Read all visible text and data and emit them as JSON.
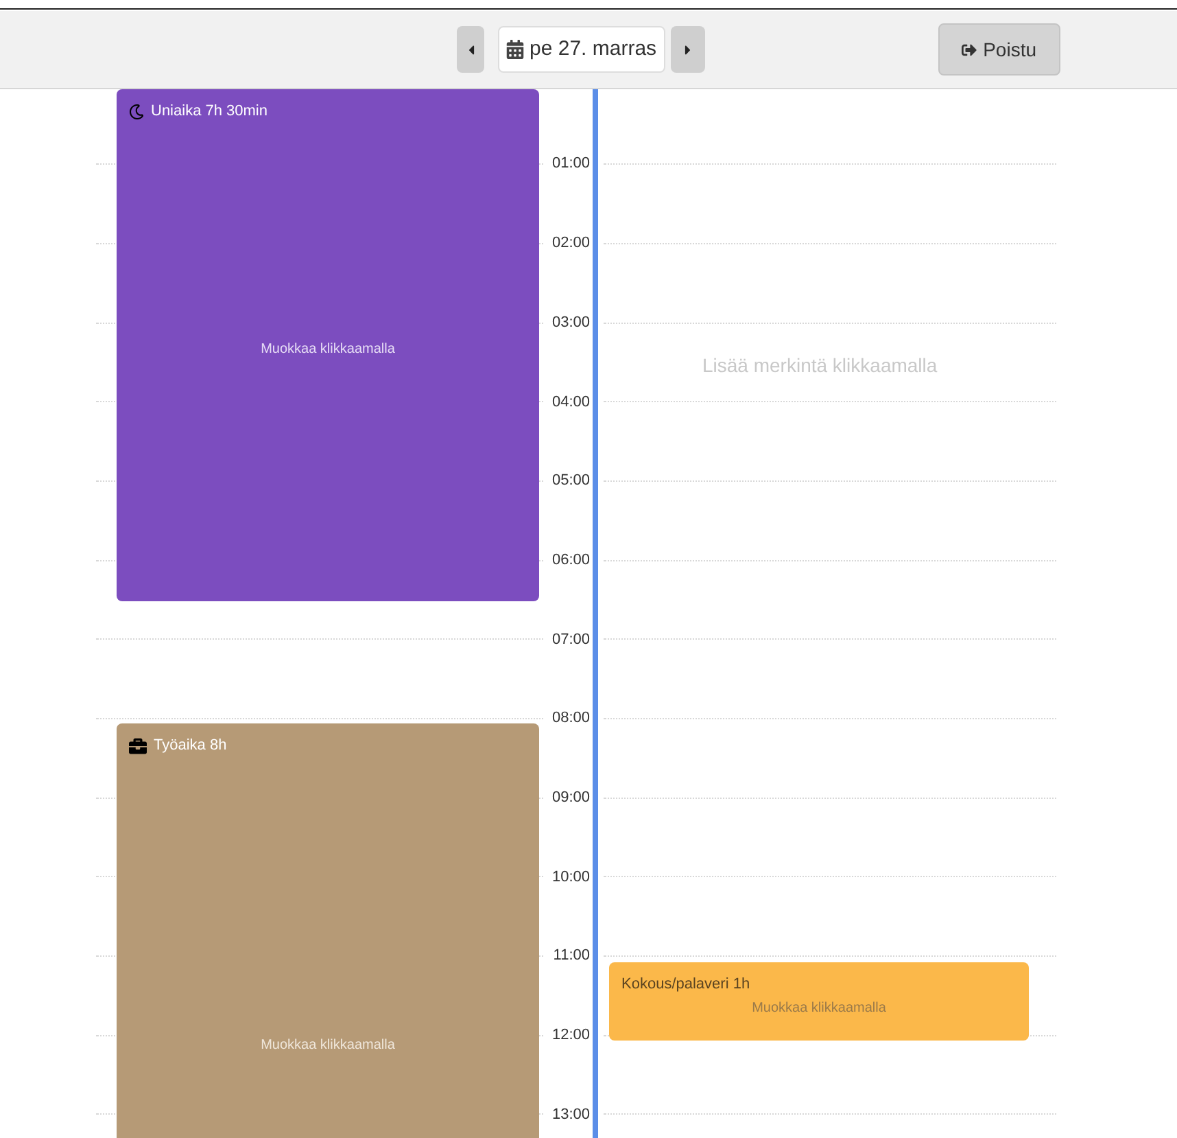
{
  "toolbar": {
    "date": "pe 27. marras",
    "logout_button": "Poistu"
  },
  "hours": [
    "01:00",
    "02:00",
    "03:00",
    "04:00",
    "05:00",
    "06:00",
    "07:00",
    "08:00",
    "09:00",
    "10:00",
    "11:00",
    "12:00",
    "13:00"
  ],
  "empty_column_hint": "Lisää merkintä klikkaamalla",
  "events": [
    {
      "kind": "sleep",
      "title": "Uniaika 7h 30min",
      "hint": "Muokkaa klikkaamalla",
      "color": "#7c4dbf"
    },
    {
      "kind": "work",
      "title": "Työaika 8h",
      "hint": "Muokkaa klikkaamalla",
      "color": "#b69a76"
    },
    {
      "kind": "meeting",
      "title": "Kokous/palaveri 1h",
      "hint": "Muokkaa klikkaamalla",
      "color": "#fbb84a"
    }
  ]
}
